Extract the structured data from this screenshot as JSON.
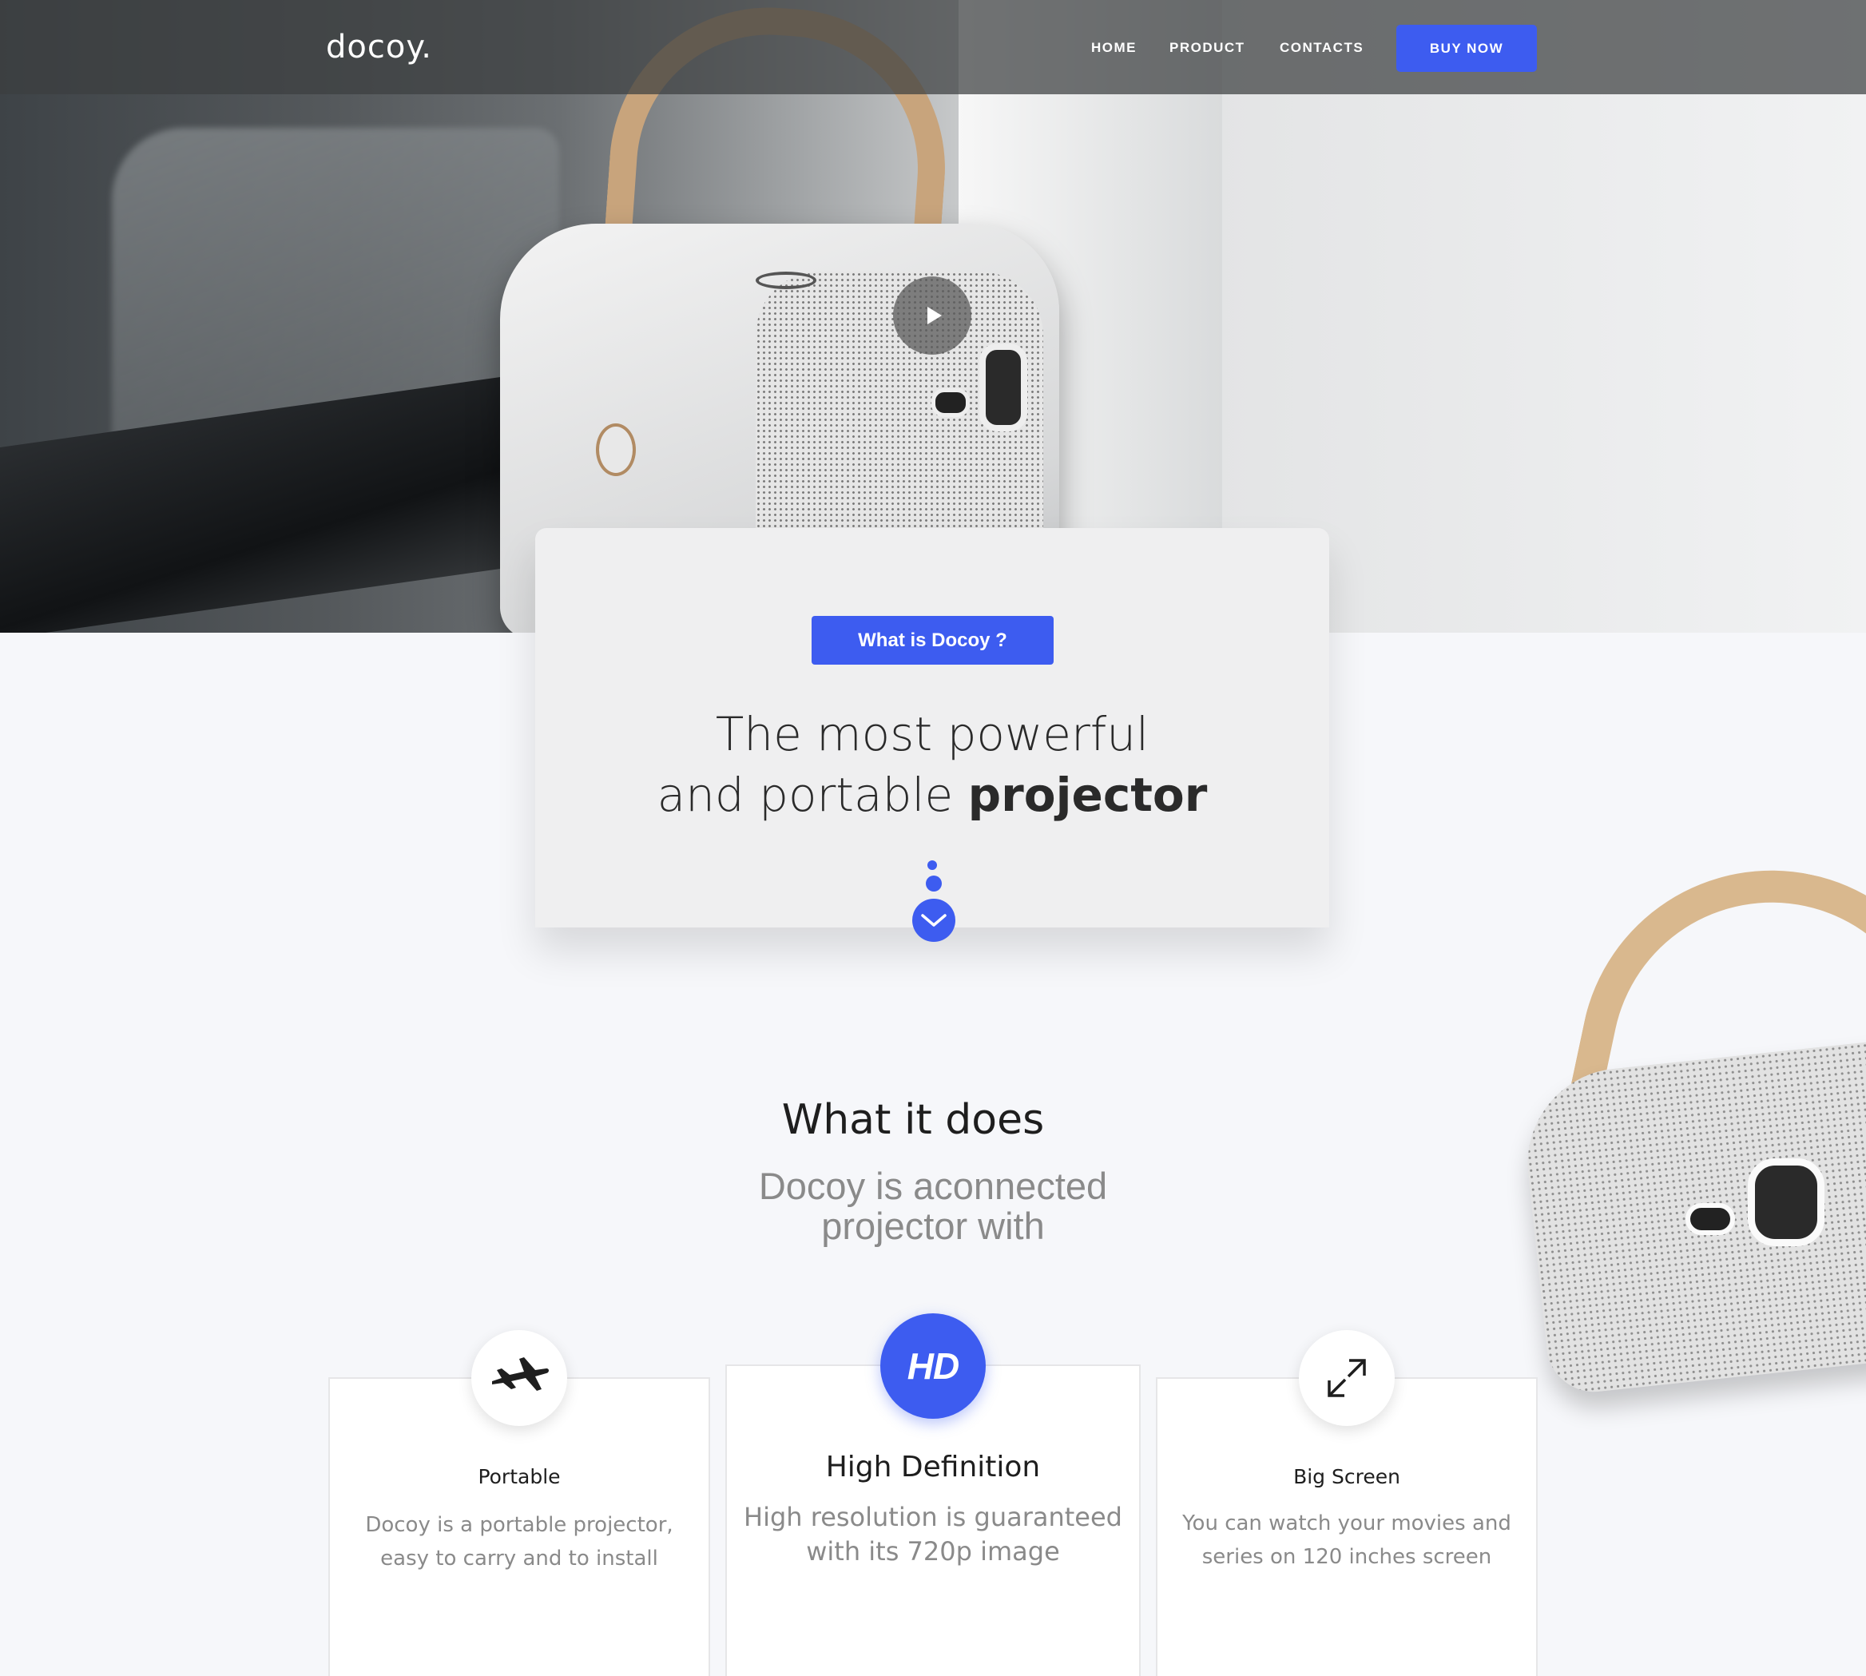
{
  "nav": {
    "logo": "docoy.",
    "links": [
      "HOME",
      "PRODUCT",
      "CONTACTS"
    ],
    "cta": "BUY NOW"
  },
  "hero": {
    "play_icon": "play-icon"
  },
  "intro": {
    "badge": "What is Docoy ?",
    "headline_line1": "The most powerful",
    "headline_line2_prefix": "and portable",
    "headline_line2_bold": "projector",
    "scroll_icon": "chevron-down-icon"
  },
  "what_it_does": {
    "title": "What it does",
    "subtitle_line1": "Docoy is aconnected",
    "subtitle_line2": "projector with"
  },
  "features": [
    {
      "icon": "airplane-icon",
      "title": "Portable",
      "desc_line1": "Docoy is a portable projector,",
      "desc_line2": "easy to carry and to install"
    },
    {
      "icon": "hd-icon",
      "icon_text": "HD",
      "title": "High Definition",
      "desc_line1": "High resolution is guaranteed",
      "desc_line2": "with its 720p image"
    },
    {
      "icon": "expand-icon",
      "title": "Big Screen",
      "desc_line1": "You can watch your movies and",
      "desc_line2": "series on 120 inches screen"
    }
  ],
  "colors": {
    "accent": "#3d5cf0",
    "background": "#f6f7fa",
    "muted_text": "#8a8a8a"
  }
}
